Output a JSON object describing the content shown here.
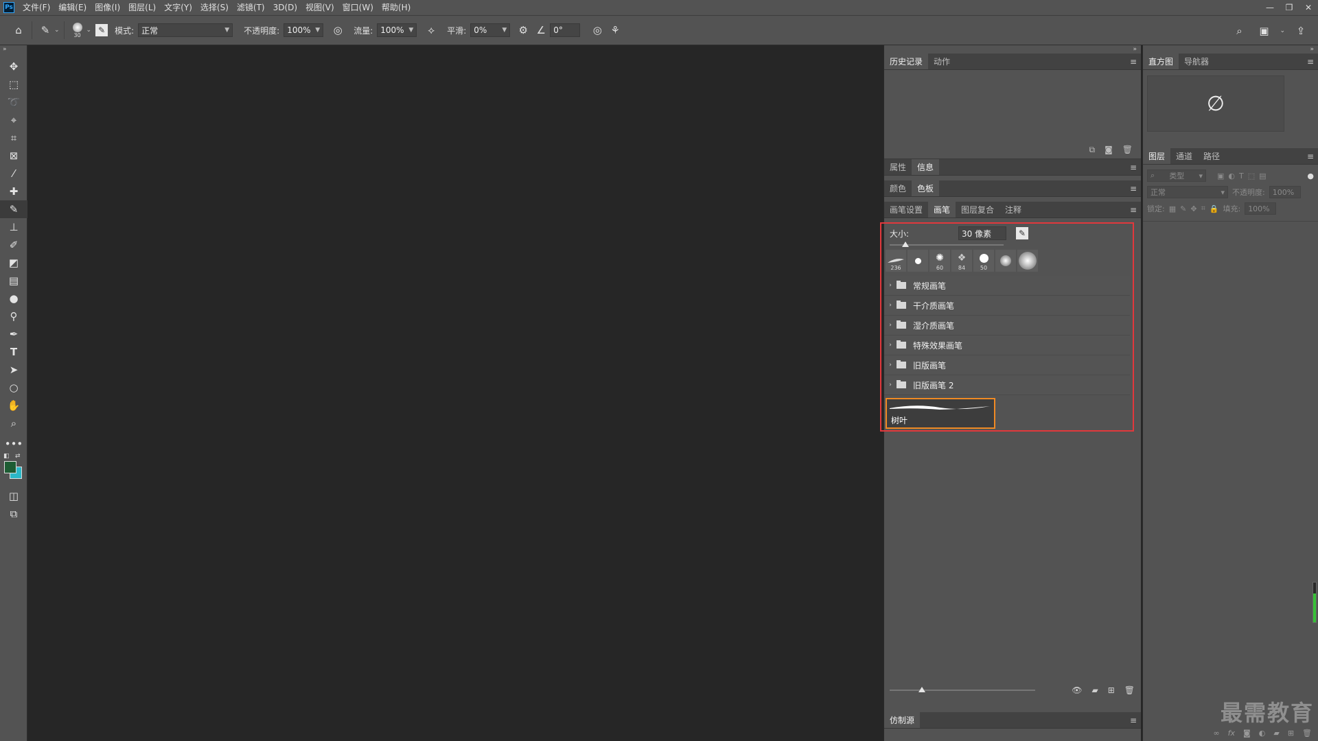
{
  "app": {
    "logo": "Ps"
  },
  "menu": [
    "文件(F)",
    "编辑(E)",
    "图像(I)",
    "图层(L)",
    "文字(Y)",
    "选择(S)",
    "滤镜(T)",
    "3D(D)",
    "视图(V)",
    "窗口(W)",
    "帮助(H)"
  ],
  "options": {
    "brush_size": "30",
    "mode_label": "模式:",
    "mode_value": "正常",
    "opacity_label": "不透明度:",
    "opacity_value": "100%",
    "flow_label": "流量:",
    "flow_value": "100%",
    "smoothing_label": "平滑:",
    "smoothing_value": "0%",
    "angle_value": "0°"
  },
  "panels": {
    "history_tabs": [
      "历史记录",
      "动作"
    ],
    "props_tabs": [
      "属性",
      "信息"
    ],
    "color_tabs": [
      "颜色",
      "色板"
    ],
    "brush_tabs": [
      "画笔设置",
      "画笔",
      "图层复合",
      "注释"
    ],
    "clone_tab": "仿制源",
    "histogram_tabs": [
      "直方图",
      "导航器"
    ],
    "layers_tabs": [
      "图层",
      "通道",
      "路径"
    ]
  },
  "brush": {
    "size_label": "大小:",
    "size_value": "30 像素",
    "recent": [
      {
        "icon": "stroke-brush-icon",
        "num": "236"
      },
      {
        "icon": "hard-round-brush-icon",
        "num": ""
      },
      {
        "icon": "splatter-brush-icon",
        "num": "60"
      },
      {
        "icon": "texture-brush-icon",
        "num": "84"
      },
      {
        "icon": "round-brush-icon",
        "num": "50"
      },
      {
        "icon": "soft-brush-icon",
        "num": ""
      },
      {
        "icon": "soft-large-brush-icon",
        "num": ""
      }
    ],
    "folders": [
      "常规画笔",
      "干介质画笔",
      "湿介质画笔",
      "特殊效果画笔",
      "旧版画笔",
      "旧版画笔 2"
    ],
    "selected_preset": "树叶"
  },
  "layers": {
    "search_placeholder": "类型",
    "blend_mode": "正常",
    "opacity_label": "不透明度:",
    "opacity_value": "100%",
    "lock_label": "锁定:",
    "fill_label": "填充:",
    "fill_value": "100%"
  },
  "histogram": {
    "empty_symbol": "∅"
  },
  "meter": {
    "level": 0.72
  },
  "watermark": "最需教育",
  "colors": {
    "highlight": "#e2383c",
    "preset_border": "#f08a24",
    "foreground": "#1d5c33",
    "background": "#2bb8c8"
  }
}
